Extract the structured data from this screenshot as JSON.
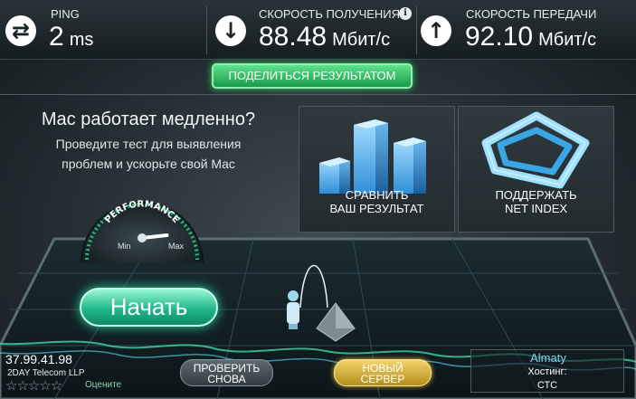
{
  "ping": {
    "label": "PING",
    "value": "2",
    "unit": "ms",
    "icon": "exchange-arrows-icon"
  },
  "download": {
    "label": "СКОРОСТЬ ПОЛУЧЕНИЯ",
    "value": "88.48",
    "unit": "Мбит/с",
    "icon": "arrow-down-icon",
    "info_icon": "i"
  },
  "upload": {
    "label": "СКОРОСТЬ ПЕРЕДАЧИ",
    "value": "92.10",
    "unit": "Мбит/с",
    "icon": "arrow-up-icon"
  },
  "share_button": "ПОДЕЛИТЬСЯ РЕЗУЛЬТАТОМ",
  "promo": {
    "title": "Mac работает медленно?",
    "line1": "Проведите тест для выявления",
    "line2": "проблем и ускорьте свой Mac"
  },
  "tiles": {
    "compare": {
      "line1": "СРАВНИТЬ",
      "line2": "ВАШ РЕЗУЛЬТАТ"
    },
    "support": {
      "line1": "ПОДДЕРЖАТЬ",
      "line2": "NET INDEX"
    }
  },
  "gauge": {
    "label": "PERFORMANCE",
    "min": "Min",
    "max": "Max",
    "level": 0.95
  },
  "start_button": "Начать",
  "client": {
    "ip": "37.99.41.98",
    "isp": "2DAY Telecom LLP",
    "rate_label": "Оцените",
    "stars_total": 5,
    "stars_filled": 0
  },
  "buttons": {
    "retest": {
      "line1": "ПРОВЕРИТЬ",
      "line2": "СНОВА"
    },
    "new_server": {
      "line1": "НОВЫЙ",
      "line2": "СЕРВЕР"
    }
  },
  "host": {
    "city": "Almaty",
    "label": "Хостинг:",
    "name": "СТС"
  },
  "colors": {
    "accent_green": "#1fc46a",
    "accent_teal": "#20b88a",
    "gold": "#e5b834",
    "city_blue": "#7fd3f0"
  }
}
